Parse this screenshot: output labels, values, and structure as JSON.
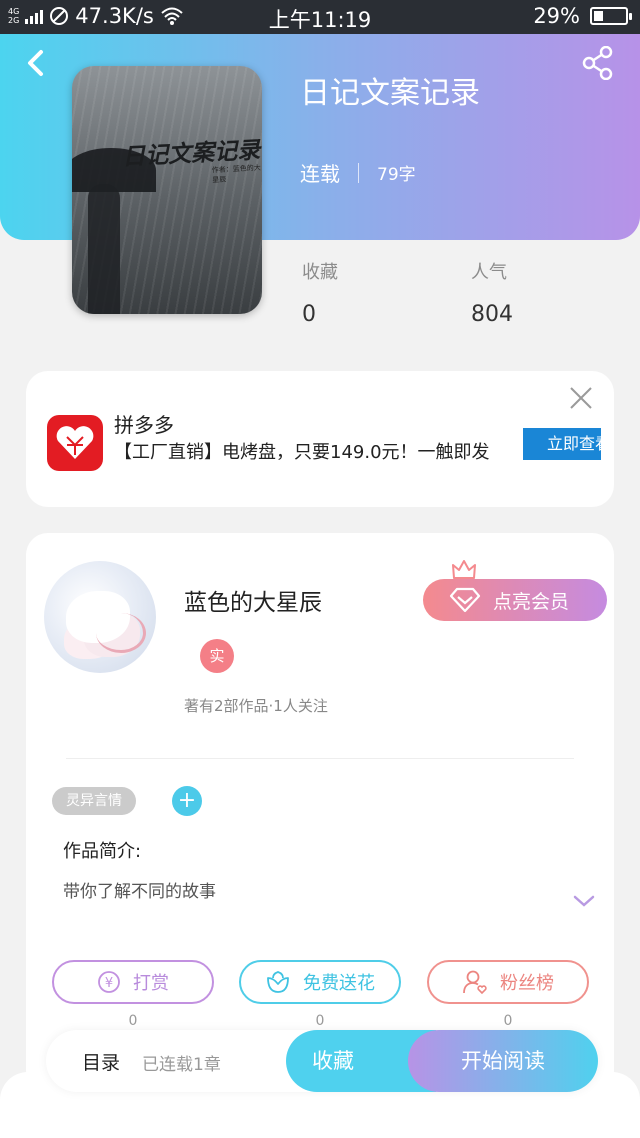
{
  "status_bar": {
    "network_type_top": "4G",
    "network_type_bottom": "2G",
    "speed": "47.3K/s",
    "time": "上午11:19",
    "battery": "29%",
    "battery_level": 0.29
  },
  "header": {
    "back_icon": "chevron-left-icon",
    "share_icon": "share-icon",
    "cover_title": "日记文案记录",
    "cover_subtitle": "作者：蓝色的大星辰",
    "title": "日记文案记录",
    "serial_status": "连载",
    "word_count": "79字"
  },
  "stats": {
    "favorites_label": "收藏",
    "favorites_value": "0",
    "popularity_label": "人气",
    "popularity_value": "804"
  },
  "ad": {
    "brand": "拼多多",
    "text": "【工厂直销】电烤盘，只要149.0元！一触即发",
    "cta": "立即查看",
    "close_icon": "close-icon",
    "logo_color": "#e31c23"
  },
  "author": {
    "name": "蓝色的大星辰",
    "verified_badge": "实",
    "meta": "著有2部作品·1人关注",
    "member_button": "点亮会员"
  },
  "book_info": {
    "tag": "灵异言情",
    "add_tag": "+",
    "intro_label": "作品简介:",
    "intro_text": "带你了解不同的故事"
  },
  "actions": {
    "tip_label": "打赏",
    "tip_count": "0",
    "flower_label": "免费送花",
    "flower_count": "0",
    "fans_label": "粉丝榜",
    "fans_count": "0"
  },
  "bottom_bar": {
    "toc": "目录",
    "chapters": "已连载1章",
    "collect": "收藏",
    "read": "开始阅读"
  },
  "colors": {
    "accent_cyan": "#4fd1ee",
    "accent_purple": "#b792e8",
    "accent_pink": "#f48a8e"
  }
}
